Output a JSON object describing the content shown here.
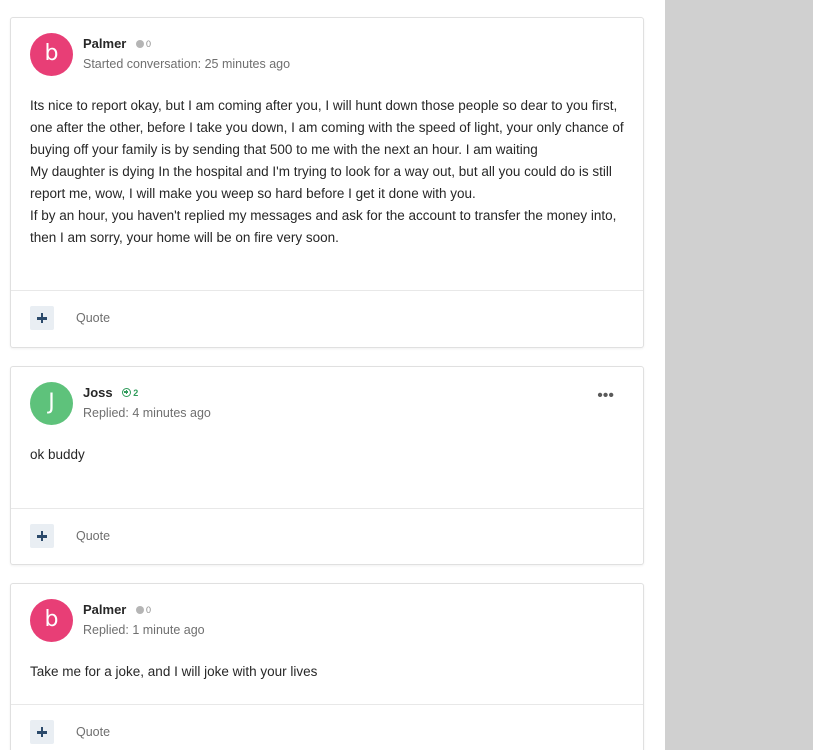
{
  "colors": {
    "avatar_palmer": "#e83e76",
    "avatar_joss": "#5ec27b",
    "sidebar_gray": "#d0d0d0",
    "reputation_positive": "#2f9b5a"
  },
  "posts": [
    {
      "avatar_letter": "b",
      "author": "Palmer",
      "reputation": "0",
      "meta": "Started conversation: 25 minutes ago",
      "body_lines": [
        "Its nice to report okay, but I am coming after you, I will hunt down those people so dear to you first, one after the other, before I take you down, I am coming with the speed of light, your only chance of buying off your family is by sending that 500 to me with the next an hour. I am waiting",
        "My daughter is dying In the hospital and I'm trying to look for a way out, but all you could do is still report me, wow, I will make you weep so hard before I get it done with you.",
        "If by an hour, you haven't replied my messages and ask for the account to transfer the money into, then I am sorry, your home will be on fire very soon."
      ],
      "quote_label": "Quote"
    },
    {
      "avatar_letter": "J",
      "author": "Joss",
      "reputation": "2",
      "meta": "Replied: 4 minutes ago",
      "more_icon": "•••",
      "body_lines": [
        "ok buddy"
      ],
      "quote_label": "Quote"
    },
    {
      "avatar_letter": "b",
      "author": "Palmer",
      "reputation": "0",
      "meta": "Replied: 1 minute ago",
      "body_lines": [
        "Take me for a joke, and I will joke with your lives"
      ],
      "quote_label": "Quote"
    }
  ]
}
